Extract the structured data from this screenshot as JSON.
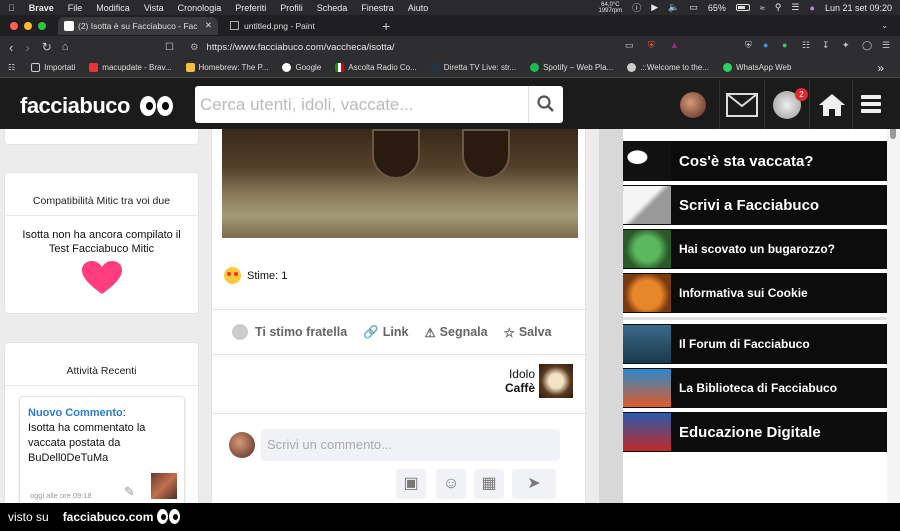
{
  "macos_menubar": {
    "apple": "",
    "app_name": "Brave",
    "menus": [
      "File",
      "Modifica",
      "Vista",
      "Cronologia",
      "Preferiti",
      "Profili",
      "Scheda",
      "Finestra",
      "Aiuto"
    ],
    "temp": "64,0°C",
    "rpm": "1997rpm",
    "battery": "65%",
    "datetime": "Lun 21 set  09:20"
  },
  "browser": {
    "tabs": [
      {
        "label": "(2) Isotta è su Facciabuco - Fac"
      },
      {
        "label": "untitled.png - Paint"
      }
    ],
    "new_tab": "+",
    "url": "https://www.facciabuco.com/vaccheca/isotta/",
    "bookmarks": [
      "Importati",
      "macupdate - Brav...",
      "Homebrew: The P...",
      "Google",
      "Ascolta Radio Co...",
      "Diretta TV Live: str...",
      "Spotify – Web Pla...",
      ".::Welcome to the...",
      "WhatsApp Web"
    ],
    "more": "»"
  },
  "site_header": {
    "logo_text": "facciabuco",
    "search_placeholder": "Cerca utenti, idoli, vaccate...",
    "notification_count": "2"
  },
  "left_column": {
    "compat_title": "Compatibilità Mitic tra voi due",
    "compat_text": "Isotta non ha ancora compilato il Test Facciabuco Mitic",
    "recent_title": "Attività Recenti",
    "activity": {
      "label": "Nuovo Commento",
      "text": "Isotta ha commentato la vaccata postata da BuDell0DeTuMa",
      "time": "oggi alle ore 09:18"
    }
  },
  "post": {
    "stime_label": "Stime: 1",
    "actions": [
      "Ti stimo fratella",
      "Link",
      "Segnala",
      "Salva"
    ],
    "idol_label": "Idolo",
    "idol_name": "Caffè",
    "comment_placeholder": "Scrivi un commento..."
  },
  "right_sidebar": {
    "links": [
      "Cos'è sta vaccata?",
      "Scrivi a Facciabuco",
      "Hai scovato un bugarozzo?",
      "Informativa sui Cookie",
      "Il Forum di Facciabuco",
      "La Biblioteca di Facciabuco",
      "Educazione Digitale"
    ]
  },
  "watermark": {
    "prefix": "visto su",
    "site": "facciabuco.com"
  },
  "colors": {
    "link_blue": "#2a7bd0",
    "heart_pink": "#ff3d7f",
    "header_bg": "#1b1b1b",
    "notif_red": "#e0282d"
  }
}
